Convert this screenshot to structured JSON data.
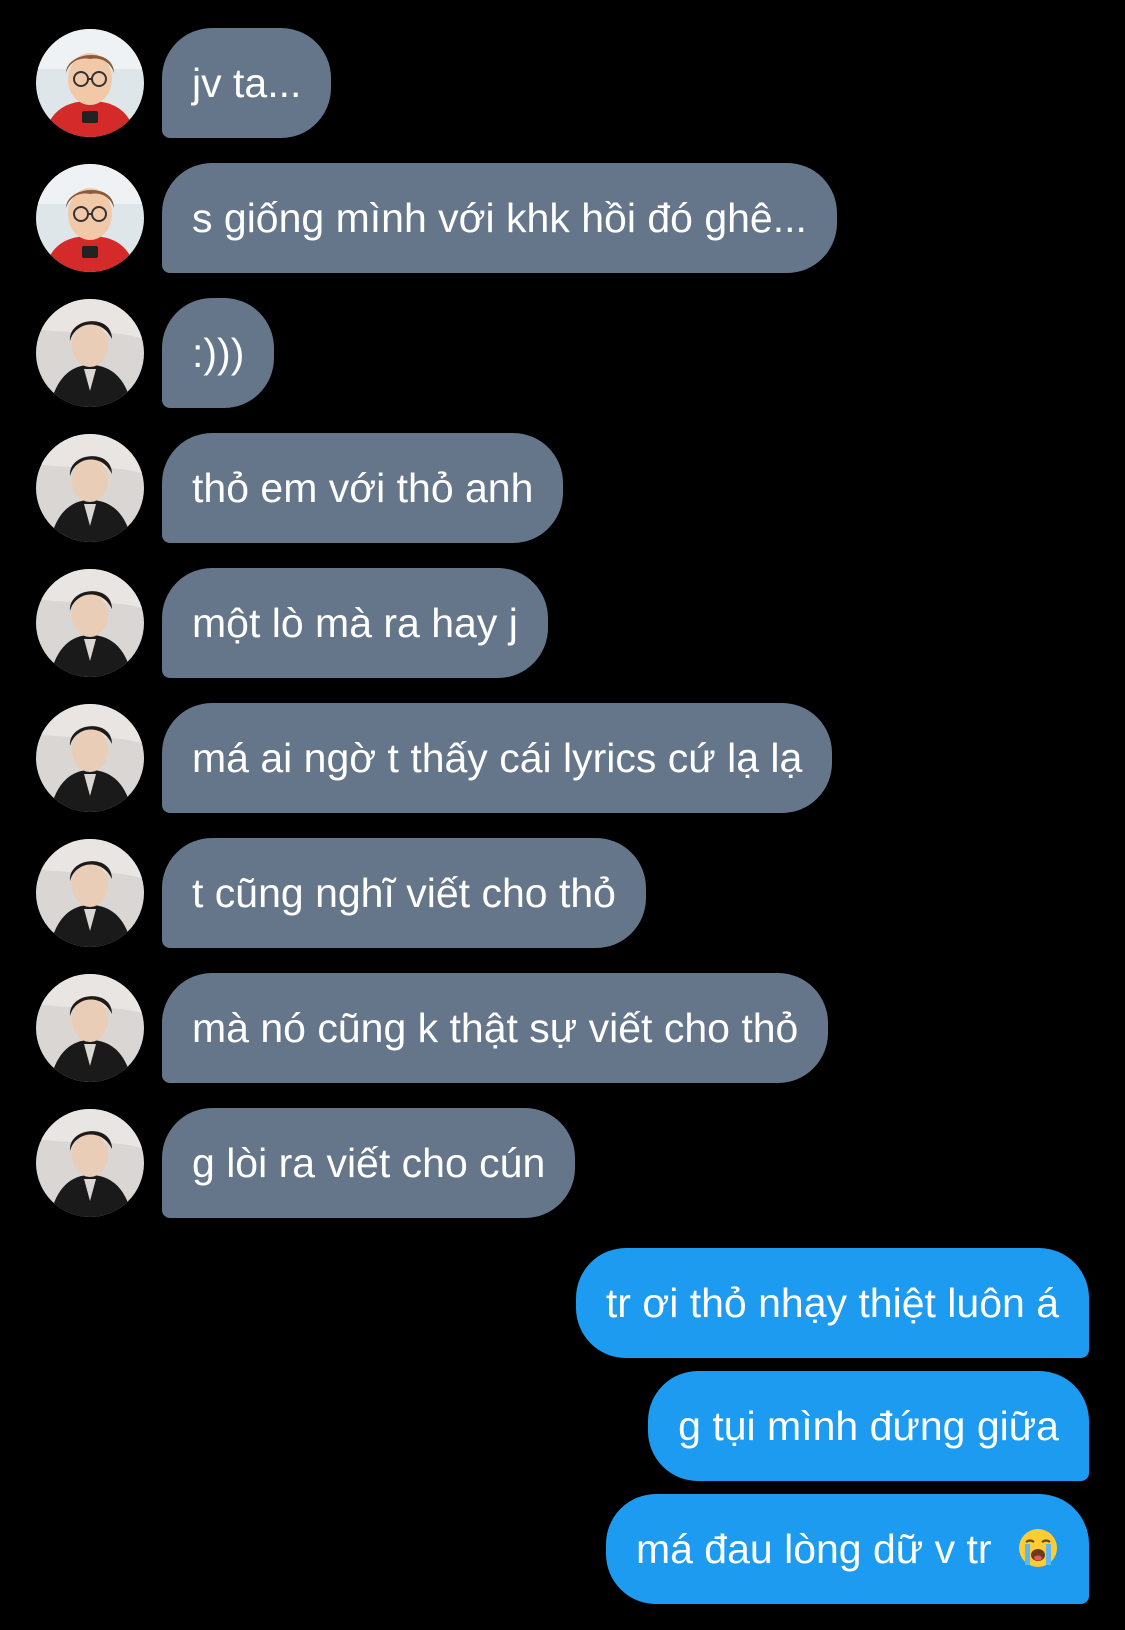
{
  "conversation": {
    "incoming": [
      {
        "text": "jv ta...",
        "avatar": "avatar-red-shirt-glasses"
      },
      {
        "text": "s giống mình với khk hồi đó ghê...",
        "avatar": "avatar-red-shirt-glasses"
      },
      {
        "text": ":)))",
        "avatar": "avatar-black-jacket"
      },
      {
        "text": "thỏ em với thỏ anh",
        "avatar": "avatar-black-jacket"
      },
      {
        "text": "một lò mà ra hay j",
        "avatar": "avatar-black-jacket"
      },
      {
        "text": "má ai ngờ t thấy cái lyrics cứ lạ lạ",
        "avatar": "avatar-black-jacket"
      },
      {
        "text": "t cũng nghĩ viết cho thỏ",
        "avatar": "avatar-black-jacket"
      },
      {
        "text": "mà nó cũng k thật sự viết cho thỏ",
        "avatar": "avatar-black-jacket"
      },
      {
        "text": "g lòi ra viết cho cún",
        "avatar": "avatar-black-jacket"
      }
    ],
    "outgoing": [
      {
        "text": "tr ơi thỏ nhạy thiệt luôn á"
      },
      {
        "text": "g tụi mình đứng giữa"
      },
      {
        "text": "má đau lòng dữ v tr",
        "emoji": "loudly-crying-face-icon"
      }
    ]
  },
  "colors": {
    "background": "#000000",
    "incoming_bubble": "#66768a",
    "outgoing_bubble": "#1d9bf0",
    "text": "#ffffff"
  }
}
